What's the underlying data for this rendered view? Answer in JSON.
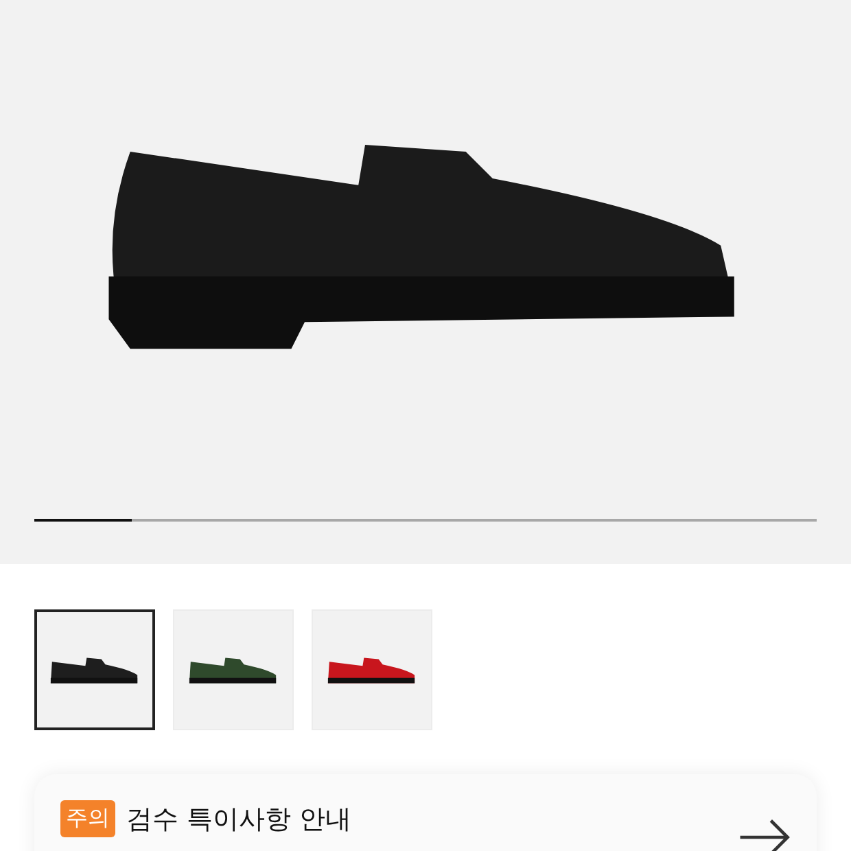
{
  "gallery": {
    "level": 0.125
  },
  "thumbnails": [
    {
      "selected": true,
      "color": "#1e1e1e"
    },
    {
      "selected": false,
      "color": "#2f4a2c"
    },
    {
      "selected": false,
      "color": "#c8161d"
    }
  ],
  "notice": {
    "badge": "주의",
    "title": "검수 특이사항 안내"
  }
}
